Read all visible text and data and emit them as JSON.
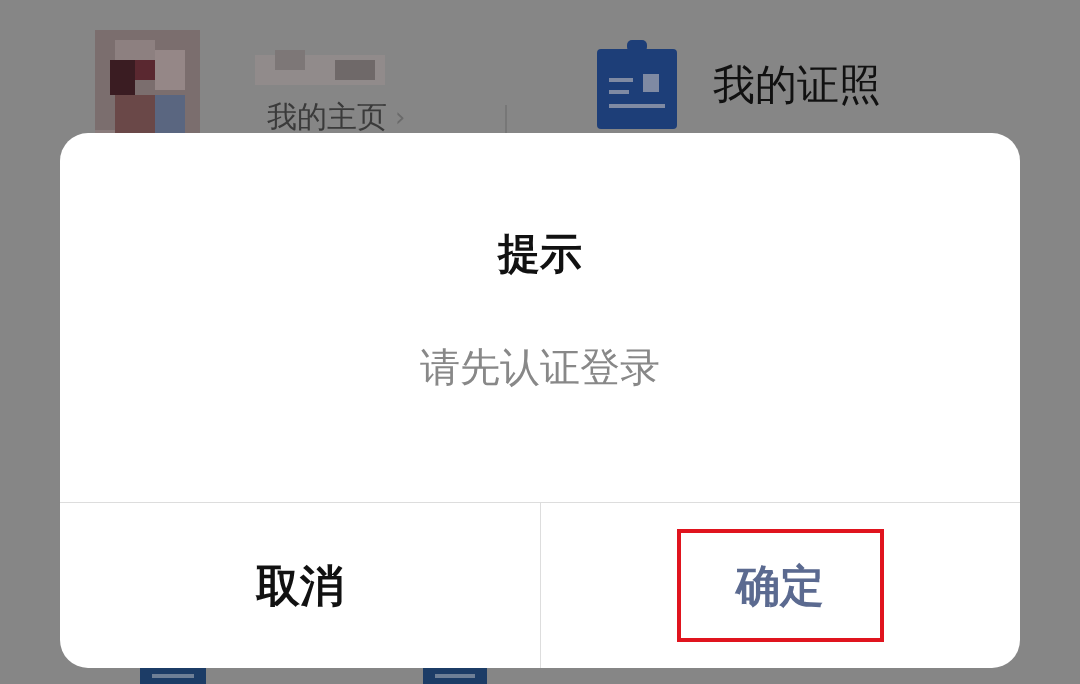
{
  "background": {
    "profile": {
      "link": "我的主页",
      "chevron": "›"
    },
    "shortcut": {
      "label": "我的证照"
    }
  },
  "dialog": {
    "title": "提示",
    "message": "请先认证登录",
    "buttons": [
      {
        "label": "取消",
        "kind": "cancel",
        "highlighted": false
      },
      {
        "label": "确定",
        "kind": "confirm",
        "highlighted": true
      }
    ]
  }
}
